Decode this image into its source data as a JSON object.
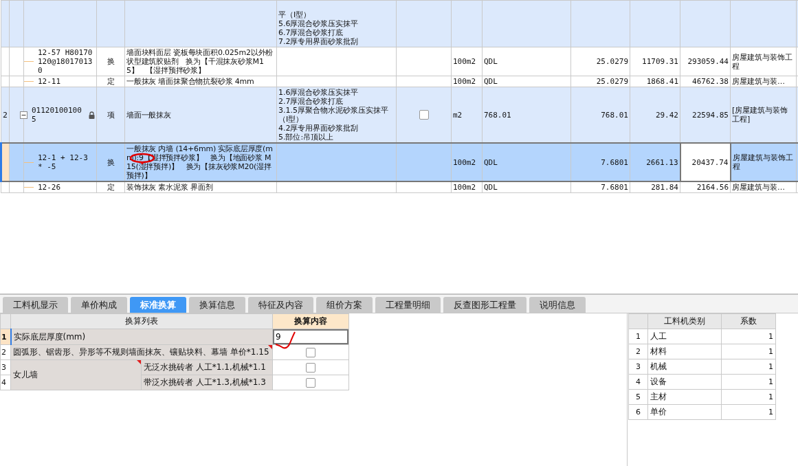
{
  "grid": {
    "bills": [
      {
        "kind": "bill",
        "selected": false,
        "features": [
          "平（Ⅰ型）",
          "5.6厚混合砂浆压实抹平",
          "6.7厚混合砂浆打底",
          "7.2厚专用界面砂浆批刮"
        ],
        "children": [
          {
            "kind": "quota",
            "selected": false,
            "code": "12-57 H80170120@180170130",
            "type": "换",
            "name": "墙面块料面层 瓷板每块面积0.025m2以外粉状型建筑胶贴剂　换为【干混抹灰砂浆M15】　【湿拌预拌砂浆】",
            "unit": "100m2",
            "expression": "QDL",
            "quantity": "25.0279",
            "unit_price": "11709.31",
            "total": "293059.44",
            "specialty": "房屋建筑与装饰工程"
          },
          {
            "kind": "quota",
            "selected": false,
            "code": "12-11",
            "type": "定",
            "name": "一般抹灰 墙面抹聚合物抗裂砂浆 4mm",
            "unit": "100m2",
            "expression": "QDL",
            "quantity": "25.0279",
            "unit_price": "1868.41",
            "total": "46762.38",
            "specialty": "房屋建筑与装…"
          }
        ]
      },
      {
        "kind": "bill",
        "selected": false,
        "row_number": "2",
        "code": "011201001005",
        "expanded": true,
        "locked": true,
        "type": "项",
        "name": "墙面一般抹灰",
        "features": [
          "1.6厚混合砂浆压实抹平",
          "2.7厚混合砂浆打底",
          "3.1.5厚聚合物水泥砂浆压实抹平（Ⅰ型）",
          "4.2厚专用界面砂浆批刮",
          "5.部位:吊顶以上"
        ],
        "checked": false,
        "unit": "m2",
        "expression": "768.01",
        "quantity": "768.01",
        "unit_price": "29.42",
        "total": "22594.85",
        "specialty": "[房屋建筑与装饰工程]",
        "children": [
          {
            "kind": "quota",
            "selected": true,
            "total_focused": true,
            "code": "12-1 + 12-3 * -5",
            "type": "换",
            "name": "一般抹灰 内墙 (14+6mm) 实际底层厚度(mm):9【湿拌预拌砂浆】　换为【地面砂浆 M15(湿拌预拌)】　换为【抹灰砂浆M20(湿拌预拌)】",
            "unit": "100m2",
            "expression": "QDL",
            "quantity": "7.6801",
            "unit_price": "2661.13",
            "total": "20437.74",
            "specialty": "房屋建筑与装饰工程"
          },
          {
            "kind": "quota",
            "selected": false,
            "code": "12-26",
            "type": "定",
            "name": "装饰抹灰 素水泥浆 界面剂",
            "unit": "100m2",
            "expression": "QDL",
            "quantity": "7.6801",
            "unit_price": "281.84",
            "total": "2164.56",
            "specialty": "房屋建筑与装…"
          }
        ]
      }
    ]
  },
  "tabs": [
    {
      "label": "工料机显示",
      "selected": false
    },
    {
      "label": "单价构成",
      "selected": false
    },
    {
      "label": "标准换算",
      "selected": true
    },
    {
      "label": "换算信息",
      "selected": false
    },
    {
      "label": "特征及内容",
      "selected": false
    },
    {
      "label": "组价方案",
      "selected": false
    },
    {
      "label": "工程量明细",
      "selected": false
    },
    {
      "label": "反查图形工程量",
      "selected": false
    },
    {
      "label": "说明信息",
      "selected": false
    }
  ],
  "conversion": {
    "columns": [
      "换算列表",
      "换算内容"
    ],
    "rows": [
      {
        "kind": "input",
        "number": "1",
        "label": "实际底层厚度(mm)",
        "value": "9",
        "selected": true,
        "note": false
      },
      {
        "kind": "checkbox",
        "number": "2",
        "label": "圆弧形、锯齿形、异形等不规则墙面抹灰、镶贴块料、幕墙 单价*1.15",
        "checked": false,
        "selected": false,
        "note": true
      },
      {
        "kind": "group",
        "label": "女儿墙",
        "note": true,
        "items": [
          {
            "number": "3",
            "label": "无泛水挑砖者 人工*1.1,机械*1.1",
            "checked": false,
            "selected": false
          },
          {
            "number": "4",
            "label": "带泛水挑砖者 人工*1.3,机械*1.3",
            "checked": false,
            "selected": false
          }
        ]
      }
    ]
  },
  "coefficients": {
    "columns": [
      "工料机类别",
      "系数"
    ],
    "rows": [
      {
        "number": "1",
        "category": "人工",
        "coefficient": "1"
      },
      {
        "number": "2",
        "category": "材料",
        "coefficient": "1"
      },
      {
        "number": "3",
        "category": "机械",
        "coefficient": "1"
      },
      {
        "number": "4",
        "category": "设备",
        "coefficient": "1"
      },
      {
        "number": "5",
        "category": "主材",
        "coefficient": "1"
      },
      {
        "number": "6",
        "category": "单价",
        "coefficient": "1"
      }
    ]
  }
}
